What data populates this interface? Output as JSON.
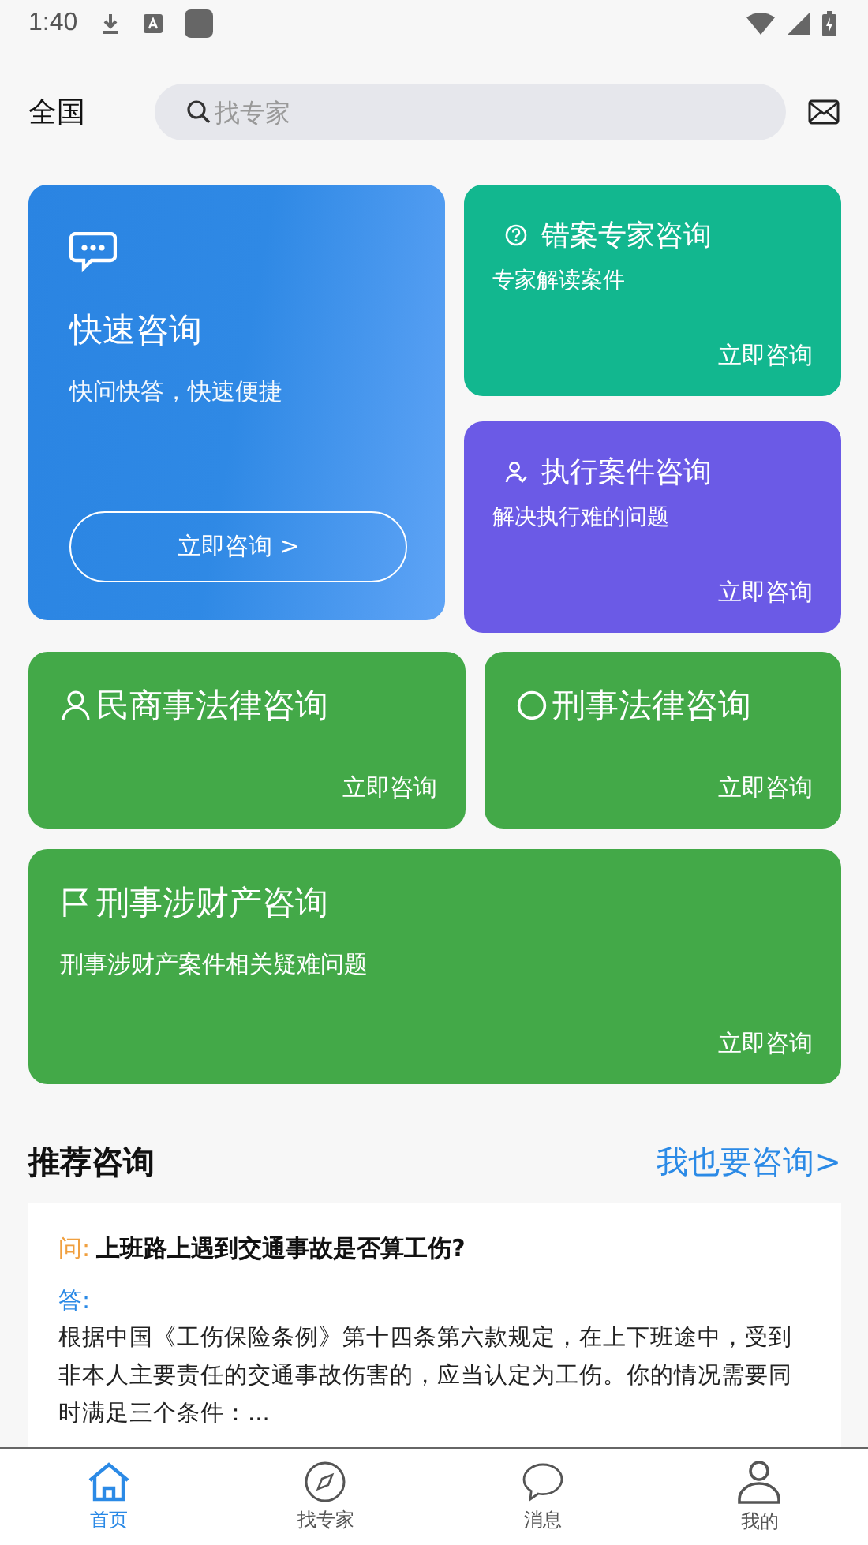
{
  "status_bar": {
    "time": "1:40"
  },
  "header": {
    "region": "全国",
    "search": {
      "placeholder": "找专家"
    }
  },
  "featured": {
    "title": "快速咨询",
    "subtitle": "快问快答，快速便捷",
    "button": "立即咨询 >"
  },
  "side_cards": [
    {
      "title": "错案专家咨询",
      "subtitle": "专家解读案件",
      "action": "立即咨询",
      "color": "#12b78f"
    },
    {
      "title": "执行案件咨询",
      "subtitle": "解决执行难的问题",
      "action": "立即咨询",
      "color": "#6b5ae6"
    }
  ],
  "half_cards": [
    {
      "title": "民商事法律咨询",
      "action": "立即咨询"
    },
    {
      "title": "刑事法律咨询",
      "action": "立即咨询"
    }
  ],
  "wide_card": {
    "title": "刑事涉财产咨询",
    "subtitle": "刑事涉财产案件相关疑难问题",
    "action": "立即咨询"
  },
  "recommend": {
    "title": "推荐咨询",
    "link": "我也要咨询>",
    "items": [
      {
        "q_label": "问:",
        "question": "上班路上遇到交通事故是否算工伤?",
        "a_label": "答:",
        "answer": "根据中国《工伤保险条例》第十四条第六款规定，在上下班途中，受到非本人主要责任的交通事故伤害的，应当认定为工伤。你的情况需要同时满足三个条件：..."
      }
    ]
  },
  "tabs": [
    {
      "label": "首页",
      "selected": true
    },
    {
      "label": "找专家",
      "selected": false
    },
    {
      "label": "消息",
      "selected": false
    },
    {
      "label": "我的",
      "selected": false
    }
  ]
}
